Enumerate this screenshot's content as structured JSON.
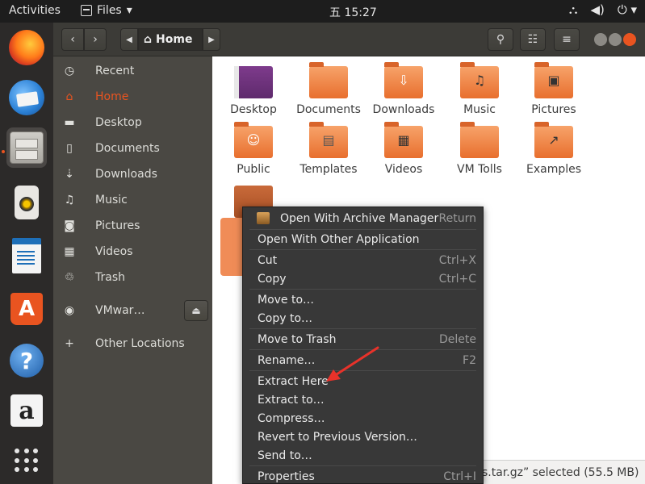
{
  "topbar": {
    "activities": "Activities",
    "app_menu": "Files",
    "app_menu_arrow": "▾",
    "clock": "五 15:27"
  },
  "header": {
    "path_home": "Home"
  },
  "sidebar": {
    "items": [
      {
        "label": "Recent",
        "icon": "clock-icon"
      },
      {
        "label": "Home",
        "icon": "home-icon"
      },
      {
        "label": "Desktop",
        "icon": "folder-icon"
      },
      {
        "label": "Documents",
        "icon": "document-icon"
      },
      {
        "label": "Downloads",
        "icon": "download-icon"
      },
      {
        "label": "Music",
        "icon": "music-icon"
      },
      {
        "label": "Pictures",
        "icon": "camera-icon"
      },
      {
        "label": "Videos",
        "icon": "video-icon"
      },
      {
        "label": "Trash",
        "icon": "trash-icon"
      },
      {
        "label": "VMwar…",
        "icon": "disc-icon"
      },
      {
        "label": "Other Locations",
        "icon": "plus-icon"
      }
    ]
  },
  "files": [
    {
      "label": "Desktop"
    },
    {
      "label": "Documents"
    },
    {
      "label": "Downloads"
    },
    {
      "label": "Music"
    },
    {
      "label": "Pictures"
    },
    {
      "label": "Public"
    },
    {
      "label": "Templates"
    },
    {
      "label": "Videos"
    },
    {
      "label": "VM Tolls"
    },
    {
      "label": "Examples"
    }
  ],
  "selected_file": {
    "line1": "VM",
    "line2": "ols",
    "line3": "99",
    "line4": "t"
  },
  "status": "s.tar.gz” selected  (55.5 MB)",
  "context_menu": {
    "items": [
      {
        "label": "Open With Archive Manager",
        "key": "Return"
      },
      {
        "label": "Open With Other Application",
        "key": ""
      },
      {
        "label": "Cut",
        "key": "Ctrl+X"
      },
      {
        "label": "Copy",
        "key": "Ctrl+C"
      },
      {
        "label": "Move to…",
        "key": ""
      },
      {
        "label": "Copy to…",
        "key": ""
      },
      {
        "label": "Move to Trash",
        "key": "Delete"
      },
      {
        "label": "Rename…",
        "key": "F2"
      },
      {
        "label": "Extract Here",
        "key": ""
      },
      {
        "label": "Extract to…",
        "key": ""
      },
      {
        "label": "Compress…",
        "key": ""
      },
      {
        "label": "Revert to Previous Version…",
        "key": ""
      },
      {
        "label": "Send to…",
        "key": ""
      },
      {
        "label": "Properties",
        "key": "Ctrl+I"
      }
    ]
  },
  "colors": {
    "accent": "#e95420",
    "annotation": "#e8322a"
  }
}
